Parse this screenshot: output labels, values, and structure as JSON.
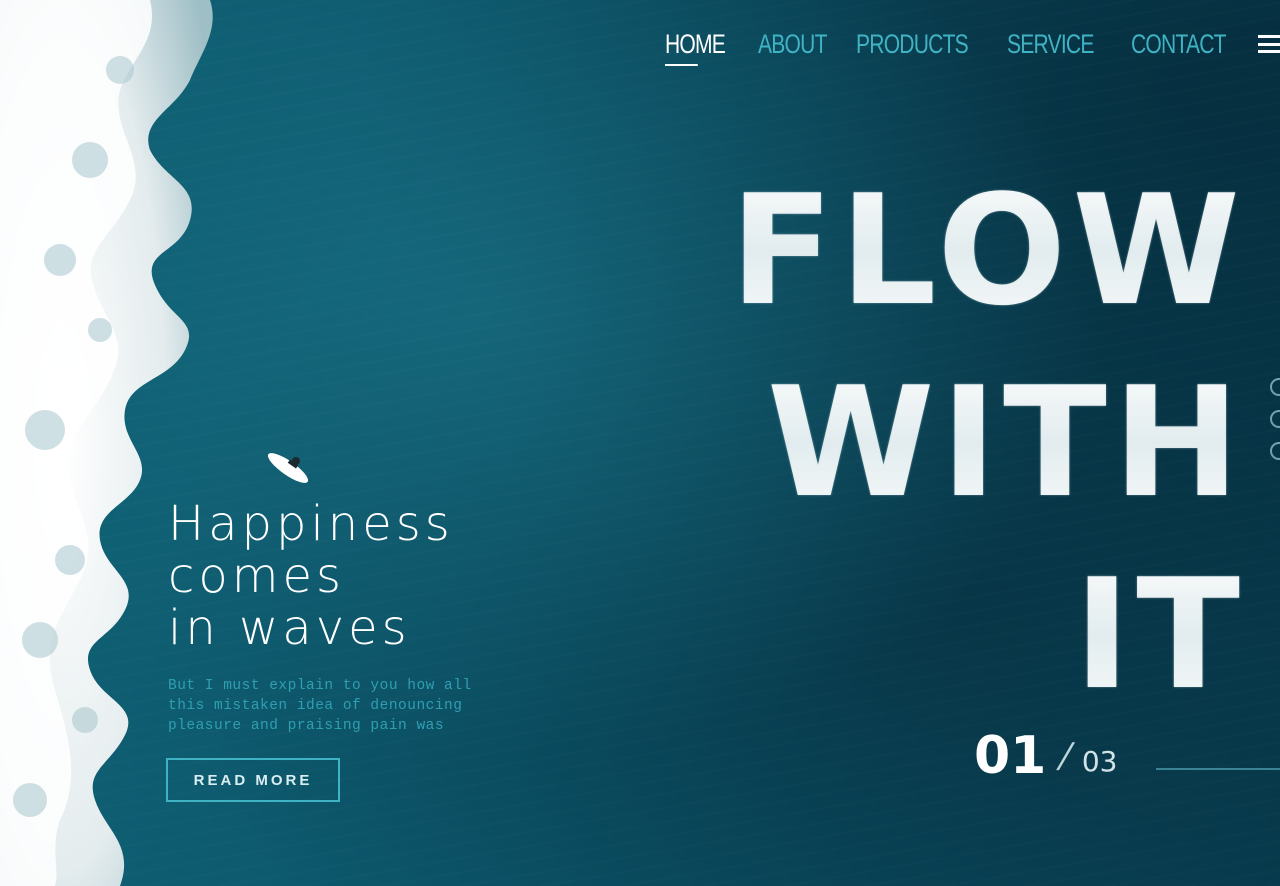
{
  "nav": {
    "items": [
      {
        "label": "HOME",
        "active": true
      },
      {
        "label": "ABOUT",
        "active": false
      },
      {
        "label": "PRODUCTS",
        "active": false
      },
      {
        "label": "SERVICE",
        "active": false
      },
      {
        "label": "CONTACT",
        "active": false
      }
    ],
    "menu_icon": "hamburger-menu-icon"
  },
  "hero": {
    "lines": [
      "FLOW",
      "WITH",
      "IT"
    ]
  },
  "tagline": {
    "lines": [
      "Happiness",
      "comes",
      "in waves"
    ]
  },
  "description": {
    "lines": [
      "But I must explain to you how all",
      "this mistaken idea of denouncing",
      "pleasure and praising pain was"
    ]
  },
  "cta": {
    "label": "READ MORE"
  },
  "pager": {
    "current": "01",
    "separator": "/",
    "total": "03"
  },
  "colors": {
    "ocean": "#0d5064",
    "accent": "#3fb3c3",
    "text": "#ffffff"
  }
}
